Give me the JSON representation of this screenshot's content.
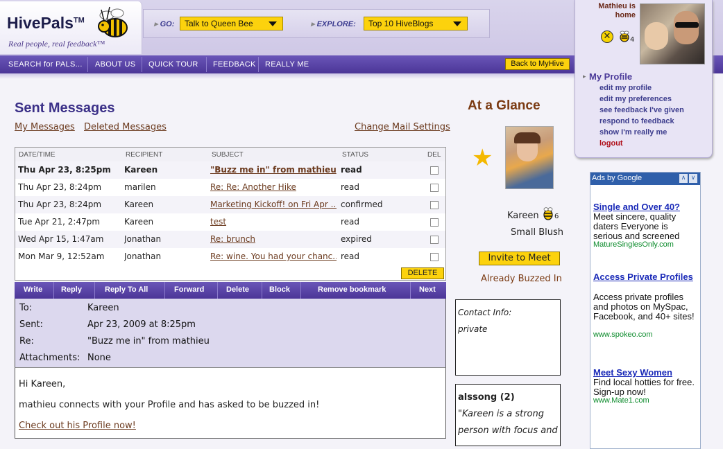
{
  "brand": {
    "name": "HivePals",
    "tm": "TM",
    "tagline": "Real people, real feedback™"
  },
  "go": {
    "label": "GO:",
    "selected": "Talk to Queen Bee"
  },
  "explore": {
    "label": "EXPLORE:",
    "selected": "Top 10 HiveBlogs"
  },
  "nav": {
    "items": [
      "SEARCH for PALS...",
      "ABOUT US",
      "QUICK TOUR",
      "FEEDBACK",
      "REALLY ME"
    ],
    "back": "Back to MyHive"
  },
  "user": {
    "home_line1": "Mathieu is",
    "home_line2": "home",
    "bee_count": "4"
  },
  "profile_menu": {
    "title": "My Profile",
    "links": [
      "edit my profile",
      "edit my preferences",
      "see feedback I've given",
      "respond to feedback",
      "show I'm really me",
      "logout"
    ]
  },
  "main": {
    "title": "Sent Messages",
    "links": {
      "my_messages": "My Messages",
      "deleted": "Deleted Messages",
      "change_mail": "Change Mail Settings"
    },
    "columns": [
      "DATE/TIME",
      "RECIPIENT",
      "SUBJECT",
      "STATUS",
      "DEL"
    ],
    "rows": [
      {
        "date": "Thu Apr 23, 8:25pm",
        "recipient": "Kareen",
        "subject": "\"Buzz me in\" from mathieu",
        "status": "read"
      },
      {
        "date": "Thu Apr 23, 8:24pm",
        "recipient": "marilen",
        "subject": "Re: Re: Another Hike",
        "status": "read"
      },
      {
        "date": "Thu Apr 23, 8:24pm",
        "recipient": "Kareen",
        "subject": "Marketing Kickoff! on Fri Apr ...",
        "status": "confirmed"
      },
      {
        "date": "Tue Apr 21, 2:47pm",
        "recipient": "Kareen",
        "subject": "test",
        "status": "read"
      },
      {
        "date": "Wed Apr 15, 1:47am",
        "recipient": "Jonathan",
        "subject": "Re: brunch",
        "status": "expired"
      },
      {
        "date": "Mon Mar 9, 12:52am",
        "recipient": "Jonathan",
        "subject": "Re: wine. You had your chanc...",
        "status": "read"
      }
    ],
    "delete_button": "DELETE"
  },
  "actions": [
    "Write",
    "Reply",
    "Reply To All",
    "Forward",
    "Delete",
    "Block",
    "Remove bookmark",
    "Next"
  ],
  "message": {
    "to_label": "To:",
    "to": "Kareen",
    "sent_label": "Sent:",
    "sent": "Apr 23, 2009 at 8:25pm",
    "re_label": "Re:",
    "re": "\"Buzz me in\" from mathieu",
    "att_label": "Attachments:",
    "att": "None",
    "greeting": "Hi Kareen,",
    "body": "mathieu connects with your Profile and has asked to be buzzed in!",
    "link": "Check out his Profile now!"
  },
  "glance": {
    "title": "At a Glance",
    "name": "Kareen",
    "bee_count": "6",
    "status": "Small Blush",
    "invite": "Invite to Meet",
    "buzzed": "Already Buzzed In",
    "contact_label": "Contact Info:",
    "contact_value": "private",
    "quote_author": "alssong (2)",
    "quote_text1": "\"Kareen is a strong",
    "quote_text2": "person with focus and"
  },
  "ads": {
    "header": "Ads by Google",
    "items": [
      {
        "title": "Single and Over 40?",
        "desc": "Meet sincere, quality daters Everyone is serious and screened",
        "url": "MatureSinglesOnly.com"
      },
      {
        "title": "Access Private Profiles",
        "desc": "Access private profiles and photos on MySpac, Facebook, and 40+ sites!",
        "url": "www.spokeo.com"
      },
      {
        "title": "Meet Sexy Women",
        "desc": "Find local hotties for free. Sign-up now!",
        "url": "www.Mate1.com"
      }
    ]
  },
  "colors": {
    "accent": "#4b3597",
    "button": "#fcd20d",
    "title": "#3b3088",
    "link": "#6b3a1e"
  }
}
